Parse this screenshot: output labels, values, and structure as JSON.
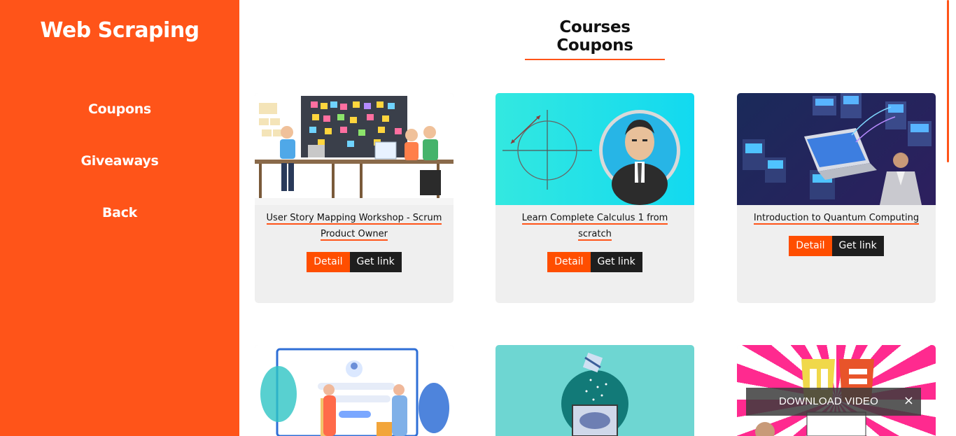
{
  "sidebar": {
    "brand": "Web Scraping",
    "items": [
      {
        "label": "Coupons"
      },
      {
        "label": "Giveaways"
      },
      {
        "label": "Back"
      }
    ]
  },
  "main": {
    "title": "Courses Coupons",
    "cards": [
      {
        "title": "User Story Mapping Workshop - Scrum Product Owner",
        "detail_label": "Detail",
        "link_label": "Get link"
      },
      {
        "title": "Learn Complete Calculus 1 from scratch",
        "detail_label": "Detail",
        "link_label": "Get link"
      },
      {
        "title": "Introduction to Quantum Computing",
        "detail_label": "Detail",
        "link_label": "Get link"
      }
    ]
  },
  "toast": {
    "label": "DOWNLOAD VIDEO",
    "close_icon": "×"
  },
  "colors": {
    "accent": "#ff5419",
    "button_detail": "#ff4e00",
    "button_link": "#1e1e1e",
    "card_bg": "#efefef"
  }
}
